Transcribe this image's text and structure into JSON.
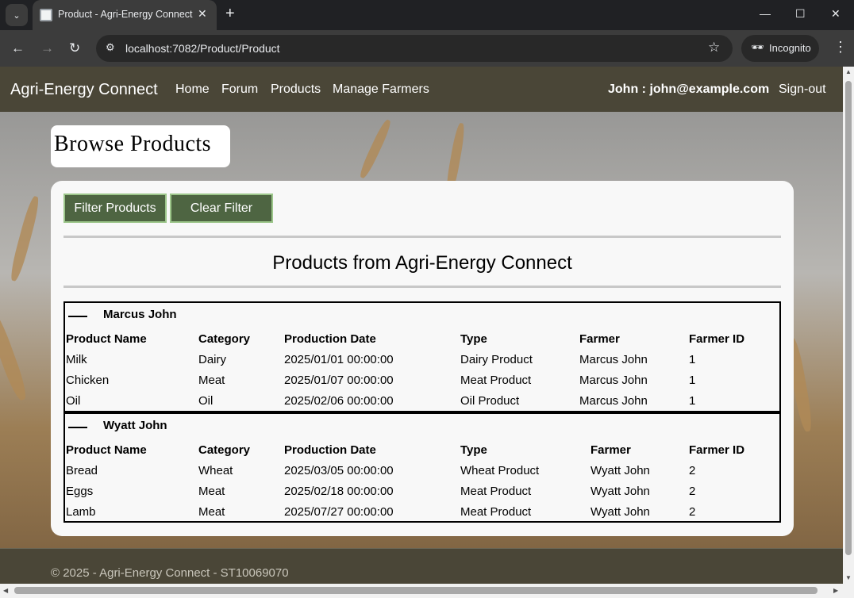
{
  "browser": {
    "tab_title": "Product - Agri-Energy Connect",
    "url": "localhost:7082/Product/Product",
    "incognito_label": "Incognito"
  },
  "nav": {
    "brand": "Agri-Energy Connect",
    "links": [
      "Home",
      "Forum",
      "Products",
      "Manage Farmers"
    ],
    "user": "John : john@example.com",
    "signout": "Sign-out"
  },
  "page_title": "Browse Products",
  "buttons": {
    "filter": "Filter Products",
    "clear": "Clear Filter"
  },
  "section_title": "Products from Agri-Energy Connect",
  "table": {
    "headers": [
      "Product Name",
      "Category",
      "Production Date",
      "Type",
      "Farmer",
      "Farmer ID"
    ],
    "groups": [
      {
        "name": "Marcus John",
        "rows": [
          [
            "Milk",
            "Dairy",
            "2025/01/01 00:00:00",
            "Dairy Product",
            "Marcus John",
            "1"
          ],
          [
            "Chicken",
            "Meat",
            "2025/01/07 00:00:00",
            "Meat Product",
            "Marcus John",
            "1"
          ],
          [
            "Oil",
            "Oil",
            "2025/02/06 00:00:00",
            "Oil Product",
            "Marcus John",
            "1"
          ]
        ]
      },
      {
        "name": "Wyatt John",
        "rows": [
          [
            "Bread",
            "Wheat",
            "2025/03/05 00:00:00",
            "Wheat Product",
            "Wyatt John",
            "2"
          ],
          [
            "Eggs",
            "Meat",
            "2025/02/18 00:00:00",
            "Meat Product",
            "Wyatt John",
            "2"
          ],
          [
            "Lamb",
            "Meat",
            "2025/07/27 00:00:00",
            "Meat Product",
            "Wyatt John",
            "2"
          ]
        ]
      }
    ]
  },
  "footer": "© 2025 - Agri-Energy Connect - ST10069070",
  "colors": {
    "navbar": "#4a4637",
    "button": "#4e6542",
    "button_border": "#9cc68a"
  }
}
